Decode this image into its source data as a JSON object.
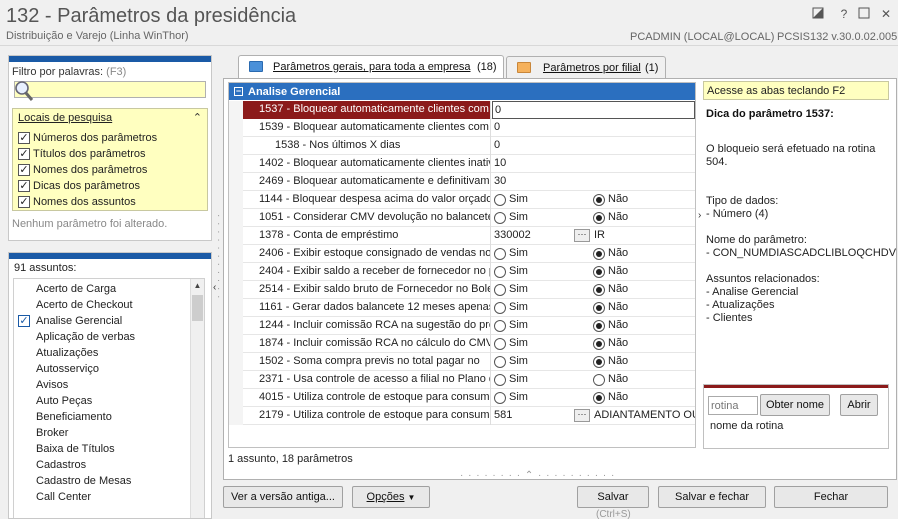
{
  "window": {
    "title": "132 - Parâmetros da presidência",
    "subtitle": "Distribuição e Varejo (Linha WinThor)",
    "user": "PCADMIN (LOCAL@LOCAL)",
    "version": "PCSIS132  v.30.0.02.005"
  },
  "filter": {
    "label": "Filtro por palavras:",
    "shortcut": "(F3)",
    "value": "",
    "locais_title": "Locais de pesquisa",
    "options": [
      {
        "label": "Números dos parâmetros",
        "checked": true
      },
      {
        "label": "Títulos dos parâmetros",
        "checked": true
      },
      {
        "label": "Nomes dos parâmetros",
        "checked": true
      },
      {
        "label": "Dicas dos parâmetros",
        "checked": true
      },
      {
        "label": "Nomes dos assuntos",
        "checked": true
      }
    ],
    "status": "Nenhum parâmetro foi alterado."
  },
  "subjects": {
    "count_label": "91 assuntos:",
    "items": [
      {
        "label": "Acerto de Carga",
        "checked": false
      },
      {
        "label": "Acerto de Checkout",
        "checked": false
      },
      {
        "label": "Analise Gerencial",
        "checked": true
      },
      {
        "label": "Aplicação de verbas",
        "checked": false
      },
      {
        "label": "Atualizações",
        "checked": false
      },
      {
        "label": "Autosserviço",
        "checked": false
      },
      {
        "label": "Avisos",
        "checked": false
      },
      {
        "label": "Auto Peças",
        "checked": false
      },
      {
        "label": "Beneficiamento",
        "checked": false
      },
      {
        "label": "Broker",
        "checked": false
      },
      {
        "label": "Baixa de Títulos",
        "checked": false
      },
      {
        "label": "Cadastros",
        "checked": false
      },
      {
        "label": "Cadastro de Mesas",
        "checked": false
      },
      {
        "label": "Call Center",
        "checked": false
      }
    ]
  },
  "tabs": [
    {
      "label": "Parâmetros gerais, para toda a empresa",
      "count": "(18)",
      "active": true
    },
    {
      "label": "Parâmetros por filial",
      "count": "(1)",
      "active": false
    }
  ],
  "grid": {
    "group": "Analise Gerencial",
    "rows": [
      {
        "name": "1537 - Bloquear automaticamente clientes com c",
        "type": "text",
        "value": "0",
        "selected": true,
        "indent": false
      },
      {
        "name": "1539 - Bloquear automaticamente clientes com c",
        "type": "text",
        "value": "0",
        "selected": false,
        "indent": false
      },
      {
        "name": "1538 - Nos últimos X dias",
        "type": "text",
        "value": "0",
        "selected": false,
        "indent": true
      },
      {
        "name": "1402 - Bloquear automaticamente clientes inativ",
        "type": "text",
        "value": "10",
        "selected": false,
        "indent": false
      },
      {
        "name": "2469 - Bloquear automaticamente e definitivame",
        "type": "text",
        "value": "30",
        "selected": false,
        "indent": false
      },
      {
        "name": "1144 - Bloquear despesa acima do valor orçado",
        "type": "radio",
        "yes": "Sim",
        "no": "Não",
        "value": "no",
        "selected": false,
        "indent": false
      },
      {
        "name": "1051 - Considerar CMV devolução no balancete",
        "type": "radio",
        "yes": "Sim",
        "no": "Não",
        "value": "no",
        "selected": false,
        "indent": false
      },
      {
        "name": "1378 - Conta de empréstimo",
        "type": "lookup",
        "value": "330002",
        "extra": "IR",
        "selected": false,
        "indent": false
      },
      {
        "name": "2406 - Exibir estoque consignado de vendas no",
        "type": "radio",
        "yes": "Sim",
        "no": "Não",
        "value": "no",
        "selected": false,
        "indent": false
      },
      {
        "name": "2404 - Exibir saldo a receber de fornecedor no p",
        "type": "radio",
        "yes": "Sim",
        "no": "Não",
        "value": "no",
        "selected": false,
        "indent": false
      },
      {
        "name": "2514 - Exibir saldo bruto de Fornecedor no Bole",
        "type": "radio",
        "yes": "Sim",
        "no": "Não",
        "value": "no",
        "selected": false,
        "indent": false
      },
      {
        "name": "1161 - Gerar dados balancete 12 meses apenas",
        "type": "radio",
        "yes": "Sim",
        "no": "Não",
        "value": "no",
        "selected": false,
        "indent": false
      },
      {
        "name": "1244 - Incluir comissão RCA na sugestão do pre",
        "type": "radio",
        "yes": "Sim",
        "no": "Não",
        "value": "no",
        "selected": false,
        "indent": false
      },
      {
        "name": "1874 - Incluir comissão RCA no cálculo do CMV d",
        "type": "radio",
        "yes": "Sim",
        "no": "Não",
        "value": "no",
        "selected": false,
        "indent": false
      },
      {
        "name": "1502 - Soma compra previs    no total pagar no",
        "type": "radio",
        "yes": "Sim",
        "no": "Não",
        "value": "no",
        "selected": false,
        "indent": false
      },
      {
        "name": "2371 - Usa controle de acesso a filial no Plano d",
        "type": "radio",
        "yes": "Sim",
        "no": "Não",
        "value": "none",
        "selected": false,
        "indent": false
      },
      {
        "name": "4015 - Utiliza controle de estoque para consumo",
        "type": "radio",
        "yes": "Sim",
        "no": "Não",
        "value": "no",
        "selected": false,
        "indent": false
      },
      {
        "name": "2179 - Utiliza controle de estoque para consumo",
        "type": "lookup",
        "value": "581",
        "extra": "ADIANTAMENTO OU",
        "selected": false,
        "indent": false
      }
    ],
    "footer": "1 assunto, 18 parâmetros"
  },
  "side": {
    "hint": "Acesse as abas teclando F2",
    "tip_title": "Dica do parâmetro 1537:",
    "tip_text1": "O bloqueio será efetuado na rotina",
    "tip_text2": "504.",
    "type_label": "Tipo de dados:",
    "type_value": " - Número (4)",
    "name_label": "Nome do parâmetro:",
    "name_value": " - CON_NUMDIASCADCLIBLOQCHDV",
    "related_label": "Assuntos relacionados:",
    "related": [
      " - Analise Gerencial",
      " - Atualizações",
      " - Clientes"
    ],
    "rotina_placeholder": "rotina",
    "rotina_button": "Obter nome",
    "open_button": "Abrir",
    "rotina_name": "nome da rotina"
  },
  "buttons": {
    "old_version": "Ver a versão antiga...",
    "options": "Opções",
    "save": "Salvar",
    "save_close": "Salvar e fechar",
    "close": "Fechar",
    "save_shortcut": "(Ctrl+S)"
  },
  "colors": {
    "accent": "#2b6fbf",
    "selected_row": "#8b1a1a",
    "highlight": "#ffffc0"
  }
}
